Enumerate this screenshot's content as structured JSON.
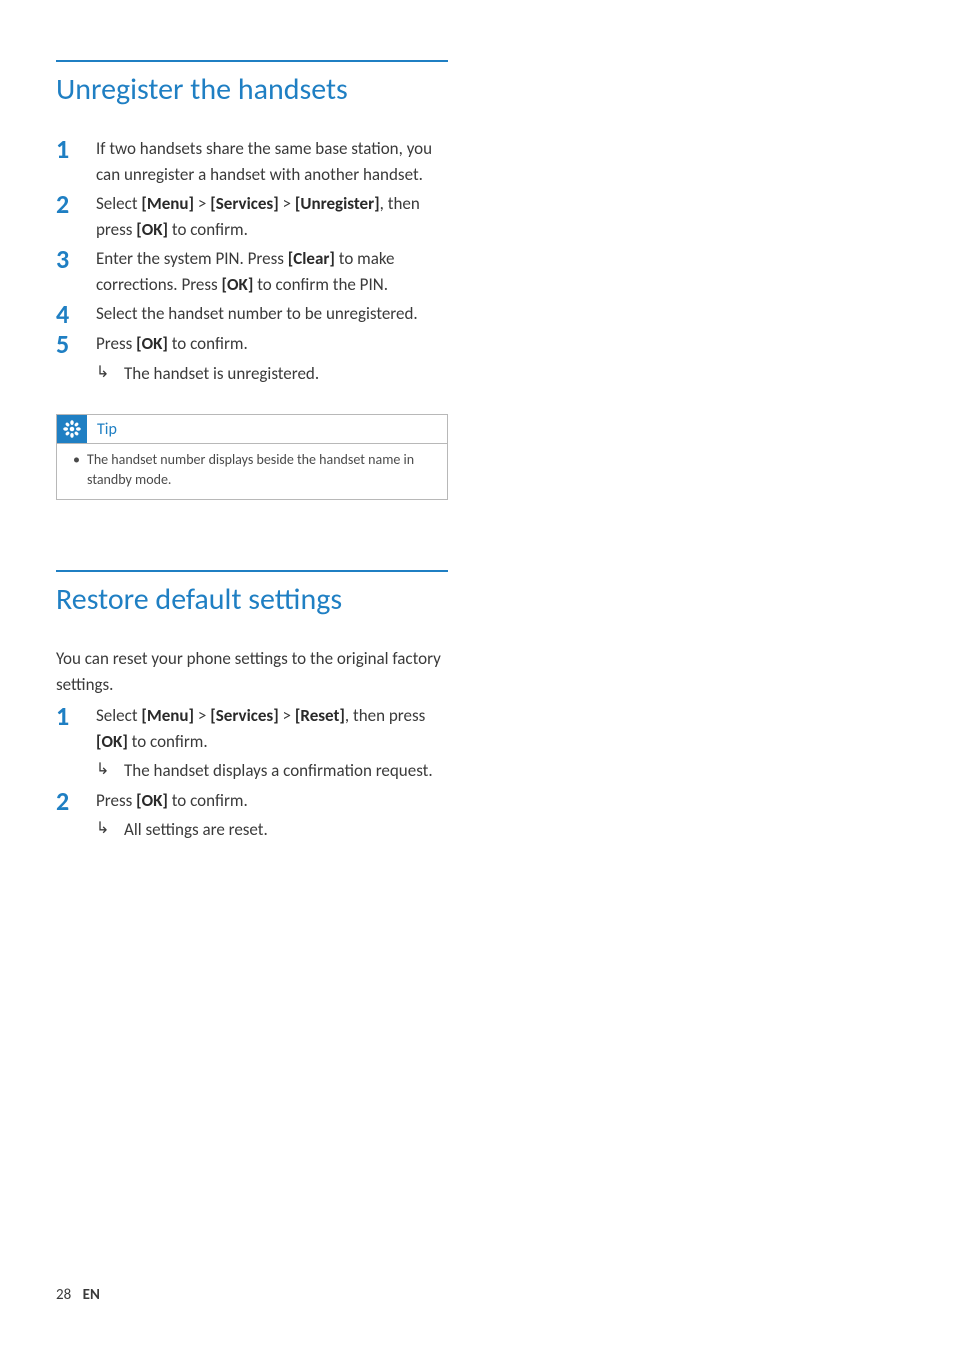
{
  "section1": {
    "title": "Unregister the handsets",
    "steps": [
      {
        "num": "1",
        "pre": "If two handsets share the same base station, you can unregister a handset with another handset."
      },
      {
        "num": "2",
        "pre": "Select ",
        "b1": "[Menu]",
        "mid1": " > ",
        "b2": "[Services]",
        "mid2": " > ",
        "b3": "[Unregister]",
        "post": ", then press ",
        "b4": "[OK]",
        "tail": " to confirm."
      },
      {
        "num": "3",
        "pre": "Enter the system PIN. Press ",
        "b1": "[Clear]",
        "mid1": " to make corrections. Press ",
        "b2": "[OK]",
        "post": " to confirm the PIN."
      },
      {
        "num": "4",
        "pre": "Select the handset number to be unregistered."
      },
      {
        "num": "5",
        "pre": "Press ",
        "b1": "[OK]",
        "post": " to confirm.",
        "result": "The handset is unregistered."
      }
    ],
    "tip_label": "Tip",
    "tip_text": "The handset number displays beside the handset name in standby mode."
  },
  "section2": {
    "title": "Restore default settings",
    "intro": "You can reset your phone settings to the original factory settings.",
    "steps": [
      {
        "num": "1",
        "pre": "Select ",
        "b1": "[Menu]",
        "mid1": " > ",
        "b2": "[Services]",
        "mid2": " > ",
        "b3": "[Reset]",
        "post": ", then press ",
        "b4": "[OK]",
        "tail": " to confirm.",
        "result": "The handset displays a confirmation request."
      },
      {
        "num": "2",
        "pre": "Press ",
        "b1": "[OK]",
        "post": " to confirm.",
        "result": "All settings are reset."
      }
    ]
  },
  "footer": {
    "page": "28",
    "lang": "EN"
  }
}
